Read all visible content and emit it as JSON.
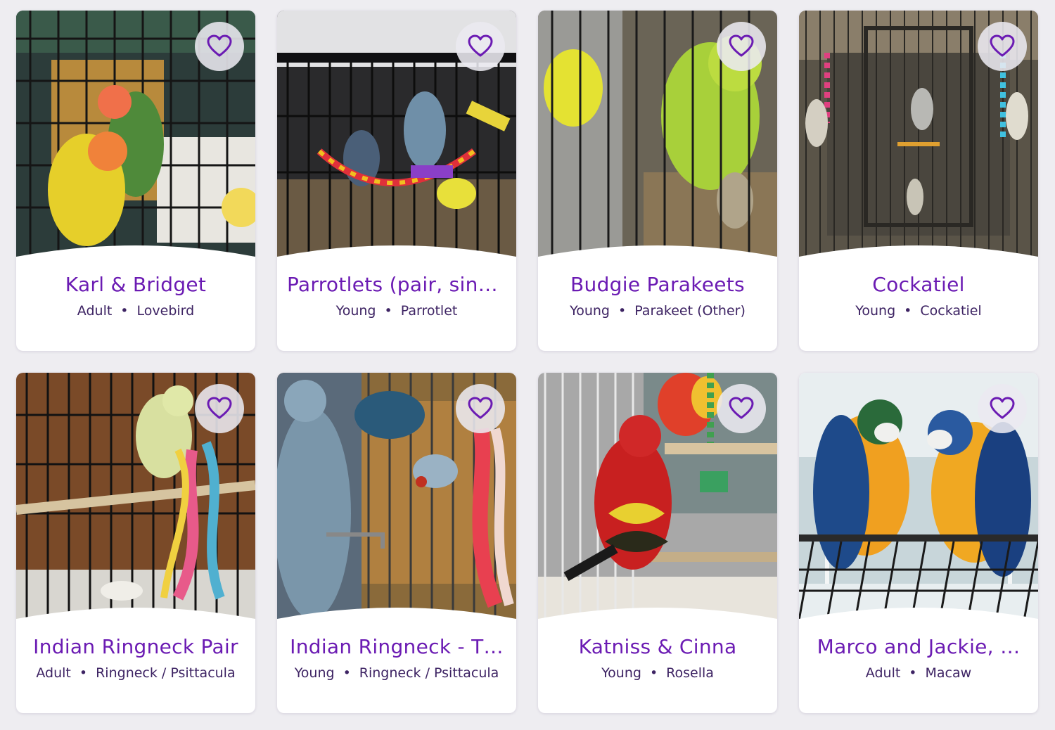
{
  "colors": {
    "accent": "#6b1bb3",
    "meta_text": "#3d2363",
    "background": "#eeedf1"
  },
  "cards": [
    {
      "name": "Karl & Bridget",
      "age": "Adult",
      "breed": "Lovebird",
      "favorite_icon": "heart-outline-icon"
    },
    {
      "name": "Parrotlets (pair, single…",
      "age": "Young",
      "breed": "Parrotlet",
      "favorite_icon": "heart-outline-icon"
    },
    {
      "name": "Budgie Parakeets",
      "age": "Young",
      "breed": "Parakeet (Other)",
      "favorite_icon": "heart-outline-icon"
    },
    {
      "name": "Cockatiel",
      "age": "Young",
      "breed": "Cockatiel",
      "favorite_icon": "heart-outline-icon"
    },
    {
      "name": "Indian Ringneck Pair",
      "age": "Adult",
      "breed": "Ringneck / Psittacula",
      "favorite_icon": "heart-outline-icon"
    },
    {
      "name": "Indian Ringneck - T…",
      "age": "Young",
      "breed": "Ringneck / Psittacula",
      "favorite_icon": "heart-outline-icon"
    },
    {
      "name": "Katniss & Cinna",
      "age": "Young",
      "breed": "Rosella",
      "favorite_icon": "heart-outline-icon"
    },
    {
      "name": "Marco and Jackie, …",
      "age": "Adult",
      "breed": "Macaw",
      "favorite_icon": "heart-outline-icon"
    }
  ]
}
